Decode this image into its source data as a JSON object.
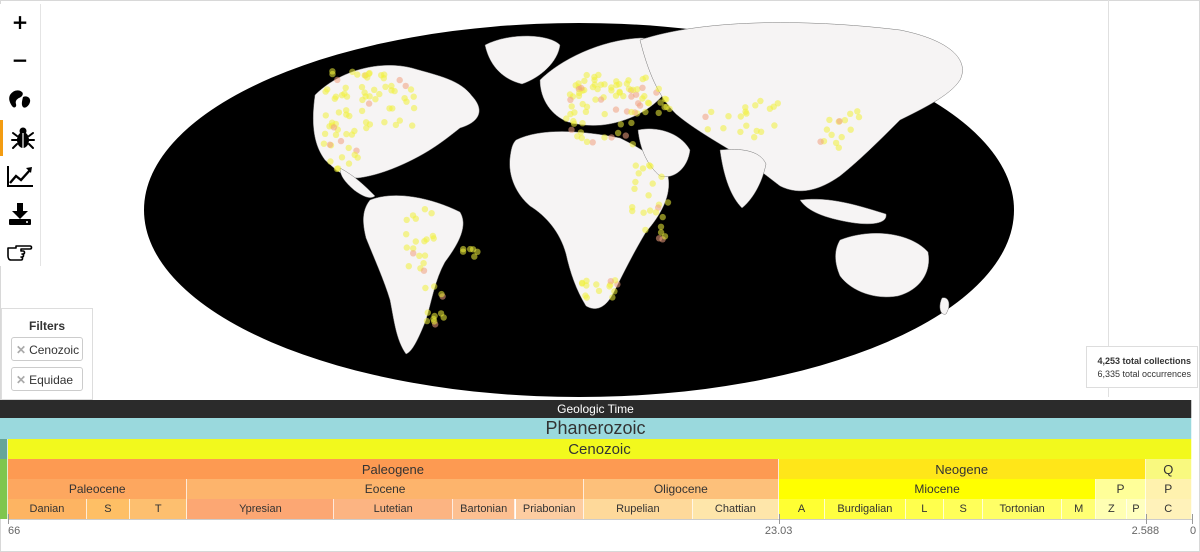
{
  "toolbar": {
    "items": [
      {
        "name": "zoom-in-button",
        "icon": "plus-icon",
        "glyph": "+"
      },
      {
        "name": "zoom-out-button",
        "icon": "minus-icon",
        "glyph": "−"
      },
      {
        "name": "paleogeography-button",
        "icon": "continents-icon",
        "glyph": ""
      },
      {
        "name": "taxa-button",
        "icon": "bug-icon",
        "glyph": "",
        "active": true
      },
      {
        "name": "diversity-button",
        "icon": "trend-chart-icon",
        "glyph": ""
      },
      {
        "name": "download-button",
        "icon": "download-icon",
        "glyph": ""
      },
      {
        "name": "help-button",
        "icon": "pointing-hand-icon",
        "glyph": ""
      }
    ],
    "accent": "#f39c12"
  },
  "filters": {
    "title": "Filters",
    "chips": [
      {
        "label": "Cenozoic"
      },
      {
        "label": "Equidae"
      }
    ]
  },
  "stats": {
    "collections": "4,253 total collections",
    "occurrences": "6,335 total occurrences"
  },
  "timescale": {
    "header": "Geologic Time",
    "eon": "Phanerozoic",
    "era": "Cenozoic",
    "periods": [
      {
        "label": "Paleogene",
        "start": 66,
        "end": 23.03,
        "color": "#FD9A52"
      },
      {
        "label": "Neogene",
        "start": 23.03,
        "end": 2.588,
        "color": "#FFE619"
      },
      {
        "label": "Q",
        "start": 2.588,
        "end": 0,
        "color": "#F9F97F"
      }
    ],
    "epochs": [
      {
        "label": "Paleocene",
        "start": 66,
        "end": 56,
        "color": "#FDA75F"
      },
      {
        "label": "Eocene",
        "start": 56,
        "end": 33.9,
        "color": "#FDB46C"
      },
      {
        "label": "Oligocene",
        "start": 33.9,
        "end": 23.03,
        "color": "#FDC07A"
      },
      {
        "label": "Miocene",
        "start": 23.03,
        "end": 5.333,
        "color": "#FFFF00"
      },
      {
        "label": "P",
        "start": 5.333,
        "end": 2.588,
        "color": "#FFFF99"
      },
      {
        "label": "P",
        "start": 2.588,
        "end": 0,
        "color": "#FFF2AE"
      }
    ],
    "ages": [
      {
        "label": "Danian",
        "start": 66,
        "end": 61.6,
        "color": "#FDB462"
      },
      {
        "label": "S",
        "start": 61.6,
        "end": 59.2,
        "color": "#FEBF65"
      },
      {
        "label": "T",
        "start": 59.2,
        "end": 56,
        "color": "#FDBF6F"
      },
      {
        "label": "Ypresian",
        "start": 56,
        "end": 47.8,
        "color": "#FCA773"
      },
      {
        "label": "Lutetian",
        "start": 47.8,
        "end": 41.2,
        "color": "#FCB482"
      },
      {
        "label": "Bartonian",
        "start": 41.2,
        "end": 37.71,
        "color": "#FDC091"
      },
      {
        "label": "Priabonian",
        "start": 37.71,
        "end": 33.9,
        "color": "#FDCDA1"
      },
      {
        "label": "Rupelian",
        "start": 33.9,
        "end": 27.82,
        "color": "#FED99A"
      },
      {
        "label": "Chattian",
        "start": 27.82,
        "end": 23.03,
        "color": "#FEE6AA"
      },
      {
        "label": "A",
        "start": 23.03,
        "end": 20.44,
        "color": "#FFFF33"
      },
      {
        "label": "Burdigalian",
        "start": 20.44,
        "end": 15.97,
        "color": "#FFFF41"
      },
      {
        "label": "L",
        "start": 15.97,
        "end": 13.82,
        "color": "#FFFF4D"
      },
      {
        "label": "S",
        "start": 13.82,
        "end": 11.63,
        "color": "#FFFF59"
      },
      {
        "label": "Tortonian",
        "start": 11.63,
        "end": 7.246,
        "color": "#FFFF66"
      },
      {
        "label": "M",
        "start": 7.246,
        "end": 5.333,
        "color": "#FFFF73"
      },
      {
        "label": "Z",
        "start": 5.333,
        "end": 3.6,
        "color": "#FFFFB3"
      },
      {
        "label": "P",
        "start": 3.6,
        "end": 2.588,
        "color": "#FFFFBF"
      },
      {
        "label": "C",
        "start": 2.588,
        "end": 0,
        "color": "#FFF2BA"
      }
    ],
    "axis_labels": [
      "66",
      "23.03",
      "2.588",
      "0"
    ],
    "axis_values": [
      66,
      23.03,
      2.588,
      0
    ],
    "colors": {
      "header": "#2b2b2b",
      "eon": "#9AD9DD",
      "era": "#F2F91D"
    }
  },
  "map": {
    "ocean_color": "#000000",
    "land_color": "#f6f4f4",
    "occurrence_color": "#f1f13a"
  }
}
